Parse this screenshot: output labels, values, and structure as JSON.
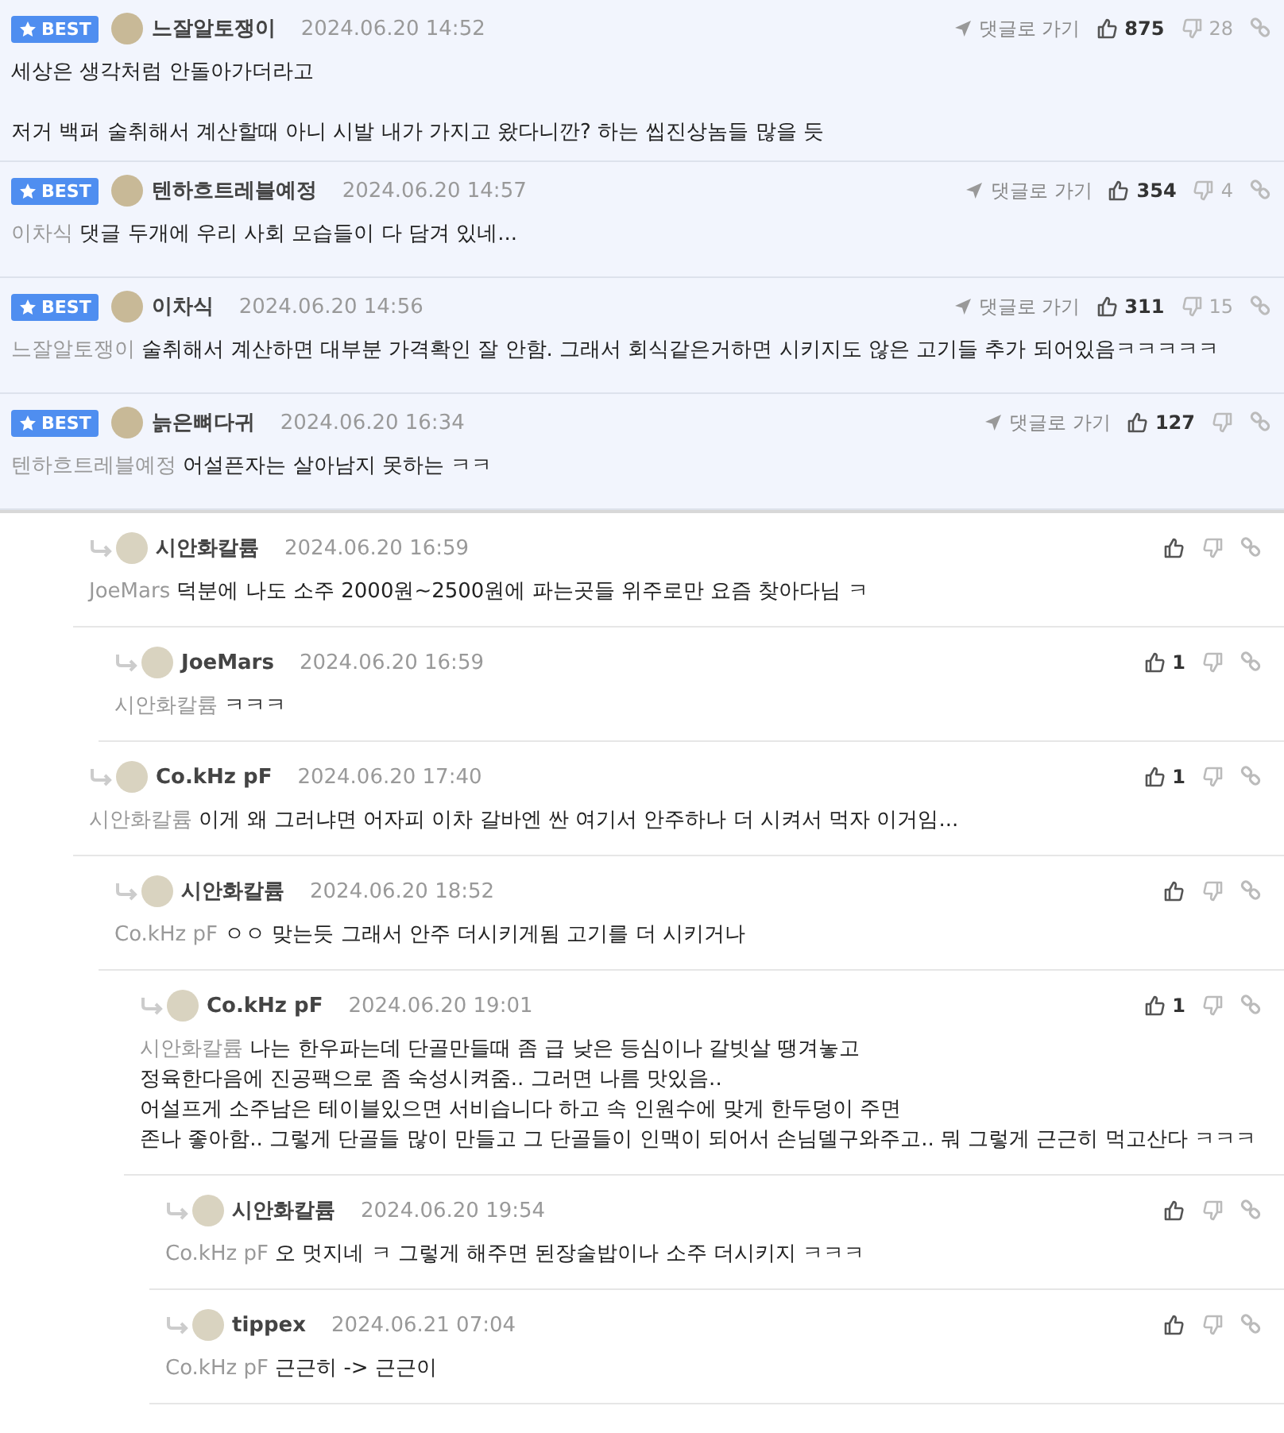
{
  "best_comments": [
    {
      "badge": "BEST",
      "author": "느잘알토쟁이",
      "date": "2024.06.20 14:52",
      "goto": "댓글로 가기",
      "likes": "875",
      "dislikes": "28",
      "text": "세상은 생각처럼 안돌아가더라고\n\n저거 백퍼 술취해서 계산할때 아니 시발 내가 가지고 왔다니깐? 하는 씹진상놈들 많을 듯"
    },
    {
      "badge": "BEST",
      "author": "텐하흐트레블예정",
      "date": "2024.06.20 14:57",
      "goto": "댓글로 가기",
      "likes": "354",
      "dislikes": "4",
      "mention": "이차식",
      "text": "댓글 두개에 우리 사회 모습들이 다 담겨 있네..."
    },
    {
      "badge": "BEST",
      "author": "이차식",
      "date": "2024.06.20 14:56",
      "goto": "댓글로 가기",
      "likes": "311",
      "dislikes": "15",
      "mention": "느잘알토쟁이",
      "text": "술취해서 계산하면 대부분 가격확인 잘 안함. 그래서 회식같은거하면 시키지도 않은 고기들 추가 되어있음ㅋㅋㅋㅋㅋ"
    },
    {
      "badge": "BEST",
      "author": "늙은뼈다귀",
      "date": "2024.06.20 16:34",
      "goto": "댓글로 가기",
      "likes": "127",
      "mention": "텐하흐트레블예정",
      "text": "어설픈자는 살아남지 못하는 ㅋㅋ"
    }
  ],
  "replies": [
    {
      "author": "시안화칼륨",
      "date": "2024.06.20 16:59",
      "mention": "JoeMars",
      "text": "덕분에 나도 소주 2000원~2500원에 파는곳들 위주로만 요즘 찾아다님 ㅋ",
      "children": [
        {
          "author": "JoeMars",
          "date": "2024.06.20 16:59",
          "likes": "1",
          "mention": "시안화칼륨",
          "text": "ㅋㅋㅋ"
        }
      ]
    },
    {
      "author": "Co.kHz pF",
      "date": "2024.06.20 17:40",
      "likes": "1",
      "mention": "시안화칼륨",
      "text": "이게 왜 그러냐면 어자피 이차 갈바엔 싼 여기서 안주하나 더 시켜서 먹자 이거임...",
      "children": [
        {
          "author": "시안화칼륨",
          "date": "2024.06.20 18:52",
          "mention": "Co.kHz pF",
          "text": "ㅇㅇ 맞는듯 그래서 안주 더시키게됨 고기를 더 시키거나",
          "children": [
            {
              "author": "Co.kHz pF",
              "date": "2024.06.20 19:01",
              "likes": "1",
              "mention": "시안화칼륨",
              "text": "나는 한우파는데 단골만들때 좀 급 낮은 등심이나 갈빗살 땡겨놓고\n정육한다음에 진공팩으로 좀 숙성시켜줌.. 그러면 나름 맛있음..\n어설프게 소주남은 테이블있으면 서비습니다 하고 속 인원수에 맞게 한두덩이 주면\n존나 좋아함.. 그렇게 단골들 많이 만들고 그 단골들이 인맥이 되어서 손님델구와주고.. 뭐 그렇게 근근히 먹고산다 ㅋㅋㅋ",
              "children": [
                {
                  "author": "시안화칼륨",
                  "date": "2024.06.20 19:54",
                  "mention": "Co.kHz pF",
                  "text": "오 멋지네 ㅋ 그렇게 해주면 된장술밥이나 소주 더시키지 ㅋㅋㅋ"
                },
                {
                  "author": "tippex",
                  "date": "2024.06.21 07:04",
                  "mention": "Co.kHz pF",
                  "text": "근근히 -> 근근이"
                }
              ]
            }
          ]
        }
      ]
    }
  ]
}
